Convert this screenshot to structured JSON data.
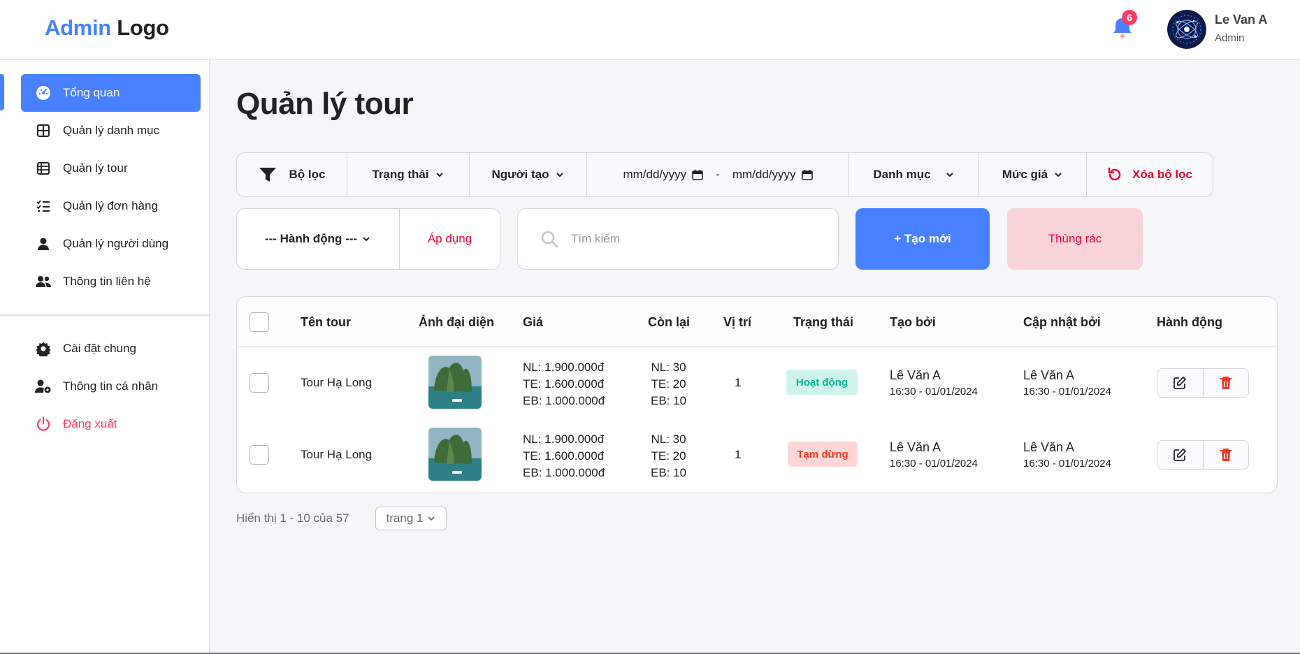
{
  "header": {
    "logo_accent": "Admin",
    "logo_rest": "Logo",
    "notification_count": "6",
    "user_name": "Le Van A",
    "user_role": "Admin"
  },
  "sidebar": {
    "items": [
      {
        "label": "Tổng quan",
        "icon": "dashboard-icon",
        "active": true
      },
      {
        "label": "Quản lý danh mục",
        "icon": "grid-icon"
      },
      {
        "label": "Quản lý tour",
        "icon": "table-icon"
      },
      {
        "label": "Quản lý đơn hàng",
        "icon": "list-check-icon"
      },
      {
        "label": "Quản lý người dùng",
        "icon": "user-icon"
      },
      {
        "label": "Thông tin liên hệ",
        "icon": "users-icon"
      }
    ],
    "bottom_items": [
      {
        "label": "Cài đặt chung",
        "icon": "gear-icon"
      },
      {
        "label": "Thông tin cá nhân",
        "icon": "user-gear-icon"
      },
      {
        "label": "Đăng xuất",
        "icon": "power-icon"
      }
    ]
  },
  "main": {
    "title": "Quản lý tour",
    "filters": {
      "filter_label": "Bộ lọc",
      "status": "Trạng thái",
      "creator": "Người tạo",
      "date_from": "mm/dd/yyyy",
      "date_sep": "-",
      "date_to": "mm/dd/yyyy",
      "category": "Danh mục",
      "price": "Mức giá",
      "reset": "Xóa bộ lọc"
    },
    "bulk_action": {
      "select": "--- Hành động ---",
      "apply": "Áp dụng"
    },
    "search": {
      "placeholder": "Tìm kiếm"
    },
    "create_button": "+ Tạo mới",
    "trash_button": "Thùng rác",
    "table": {
      "headers": [
        "Tên tour",
        "Ảnh đại diện",
        "Giá",
        "Còn lại",
        "Vị trí",
        "Trạng thái",
        "Tạo bởi",
        "Cập nhật bởi",
        "Hành động"
      ],
      "rows": [
        {
          "name": "Tour Hạ Long",
          "price": [
            "NL: 1.900.000đ",
            "TE: 1.600.000đ",
            "EB: 1.000.000đ"
          ],
          "remaining": [
            "NL: 30",
            "TE: 20",
            "EB: 10"
          ],
          "position": "1",
          "status": "Hoạt động",
          "created_by": "Lê Văn A",
          "created_at": "16:30 - 01/01/2024",
          "updated_by": "Lê Văn A",
          "updated_at": "16:30 - 01/01/2024"
        },
        {
          "name": "Tour Hạ Long",
          "price": [
            "NL: 1.900.000đ",
            "TE: 1.600.000đ",
            "EB: 1.000.000đ"
          ],
          "remaining": [
            "NL: 30",
            "TE: 20",
            "EB: 10"
          ],
          "position": "1",
          "status": "Tạm dừng",
          "created_by": "Lê Văn A",
          "created_at": "16:30 - 01/01/2024",
          "updated_by": "Lê Văn A",
          "updated_at": "16:30 - 01/01/2024"
        }
      ]
    },
    "pagination": {
      "info": "Hiển thị 1 - 10 của 57",
      "page": "trang 1"
    }
  },
  "colors": {
    "primary": "#4880ff",
    "danger": "#ea0234",
    "badge": "#f93c65",
    "active_status": "#00b69b",
    "paused_status": "#ef3826"
  }
}
